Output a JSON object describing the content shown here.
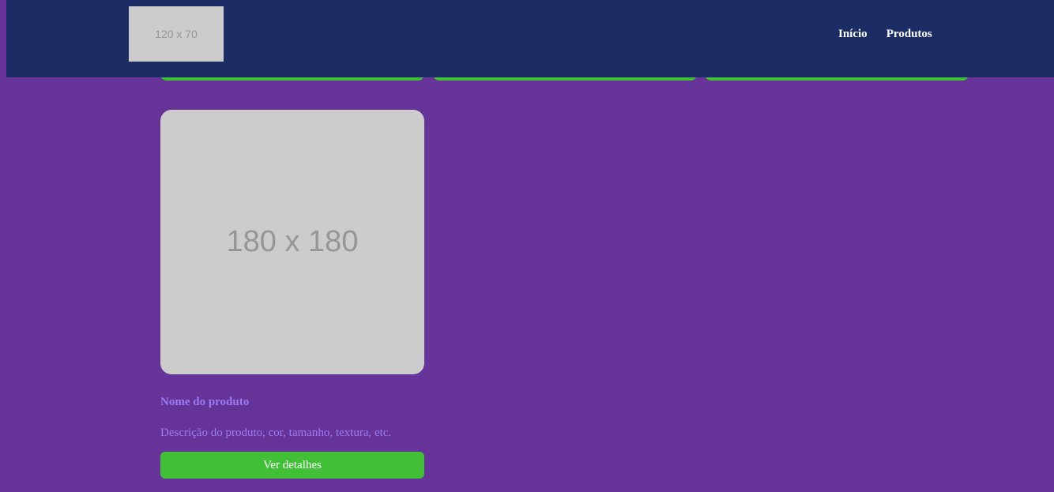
{
  "header": {
    "logo_text": "120 x 70",
    "nav": [
      {
        "label": "Início"
      },
      {
        "label": "Produtos"
      }
    ]
  },
  "product": {
    "image_text": "180 x 180",
    "name": "Nome do produto",
    "description": "Descrição do produto, cor, tamanho, textura, etc.",
    "button_label": "Ver detalhes"
  },
  "colors": {
    "background": "#663399",
    "header": "#1b2d64",
    "button": "#41bf36",
    "product_text": "#9a7cf2",
    "placeholder": "#cccccc"
  }
}
